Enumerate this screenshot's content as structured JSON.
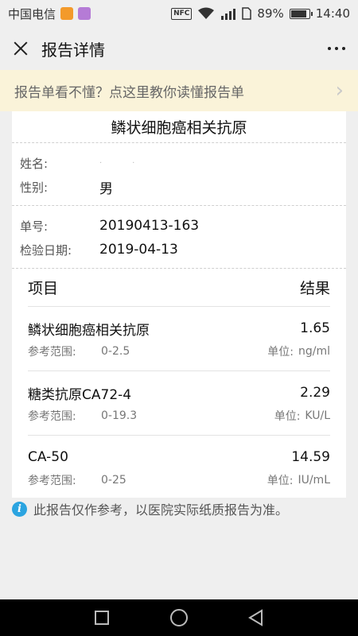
{
  "status_bar": {
    "carrier": "中国电信",
    "nfc": "NFC",
    "battery_text": "89%",
    "battery_level": 0.89,
    "time": "14:40"
  },
  "header": {
    "title": "报告详情"
  },
  "banner": {
    "text": "报告单看不懂？点这里教你读懂报告单",
    "arrow": "›"
  },
  "report": {
    "title": "鳞状细胞癌相关抗原",
    "name_label": "姓名:",
    "name_value": "",
    "gender_label": "性别:",
    "gender_value": "男",
    "order_label": "单号:",
    "order_value": "20190413-163",
    "date_label": "检验日期:",
    "date_value": "2019-04-13",
    "col_item": "项目",
    "col_result": "结果",
    "items": [
      {
        "name": "鳞状细胞癌相关抗原",
        "value": "1.65",
        "range_label": "参考范围:",
        "range": "0-2.5",
        "unit_label": "单位:",
        "unit": "ng/ml"
      },
      {
        "name": "糖类抗原CA72-4",
        "value": "2.29",
        "range_label": "参考范围:",
        "range": "0-19.3",
        "unit_label": "单位:",
        "unit": "KU/L"
      },
      {
        "name": "CA-50",
        "value": "14.59",
        "range_label": "参考范围:",
        "range": "0-25",
        "unit_label": "单位:",
        "unit": "IU/mL"
      }
    ]
  },
  "note": {
    "icon": "i",
    "text": "此报告仅作参考，以医院实际纸质报告为准。"
  },
  "icons": {
    "close": "close-icon",
    "more": "more-icon",
    "info": "info-icon",
    "accent": "#2ba4e0",
    "banner_bg": "#faf3d9"
  }
}
